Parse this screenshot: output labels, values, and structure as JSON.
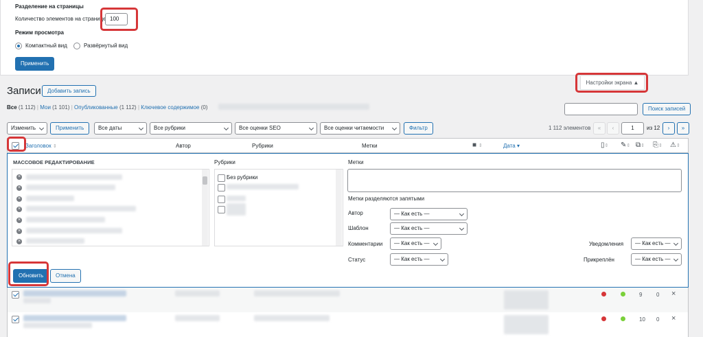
{
  "screen_options": {
    "pagination_heading": "Разделение на страницы",
    "items_per_page_label": "Количество элементов на странице:",
    "items_per_page_value": "100",
    "view_mode_heading": "Режим просмотра",
    "view_compact": "Компактный вид",
    "view_expanded": "Развёрнутый вид",
    "apply_label": "Применить",
    "toggle_label": "Настройки экрана ▲"
  },
  "page": {
    "title": "Записи",
    "add_new": "Добавить запись"
  },
  "filters_links": [
    {
      "label": "Все",
      "count": "(1 112)",
      "sep": "|"
    },
    {
      "label": "Мои",
      "count": "(1 101)",
      "sep": "|"
    },
    {
      "label": "Опубликованные",
      "count": "(1 112)",
      "sep": "|"
    },
    {
      "label": "Ключевое содержимое",
      "count": "(0)",
      "sep": ""
    }
  ],
  "search": {
    "button": "Поиск записей"
  },
  "tablenav": {
    "bulk_action": "Изменить",
    "apply": "Применить",
    "dates": "Все даты",
    "categories": "Все рубрики",
    "seo": "Все оценки SEO",
    "readability": "Все оценки читаемости",
    "filter": "Фильтр",
    "items_count": "1 112 элементов",
    "first": "«",
    "prev": "‹",
    "current_page": "1",
    "of_pages": "из 12",
    "next": "›",
    "last": "»"
  },
  "columns": {
    "title": "Заголовок",
    "author": "Автор",
    "categories": "Рубрики",
    "tags": "Метки",
    "date": "Дата"
  },
  "bulk_edit": {
    "heading": "МАССОВОЕ РЕДАКТИРОВАНИЕ",
    "categories_label": "Рубрики",
    "no_category": "Без рубрики",
    "tags_label": "Метки",
    "tags_hint": "Метки разделяются запятыми",
    "author_label": "Автор",
    "template_label": "Шаблон",
    "comments_label": "Комментарии",
    "status_label": "Статус",
    "notifications_label": "Уведомления",
    "sticky_label": "Прикреплён",
    "as_is": "— Как есть —",
    "update": "Обновить",
    "cancel": "Отмена"
  },
  "rows": [
    {
      "checked": true,
      "seo": "#d63638",
      "read": "#7ad03a",
      "links": "9",
      "linked": "0",
      "close": "×"
    },
    {
      "checked": true,
      "seo": "#d63638",
      "read": "#7ad03a",
      "links": "10",
      "linked": "0",
      "close": "×"
    }
  ]
}
